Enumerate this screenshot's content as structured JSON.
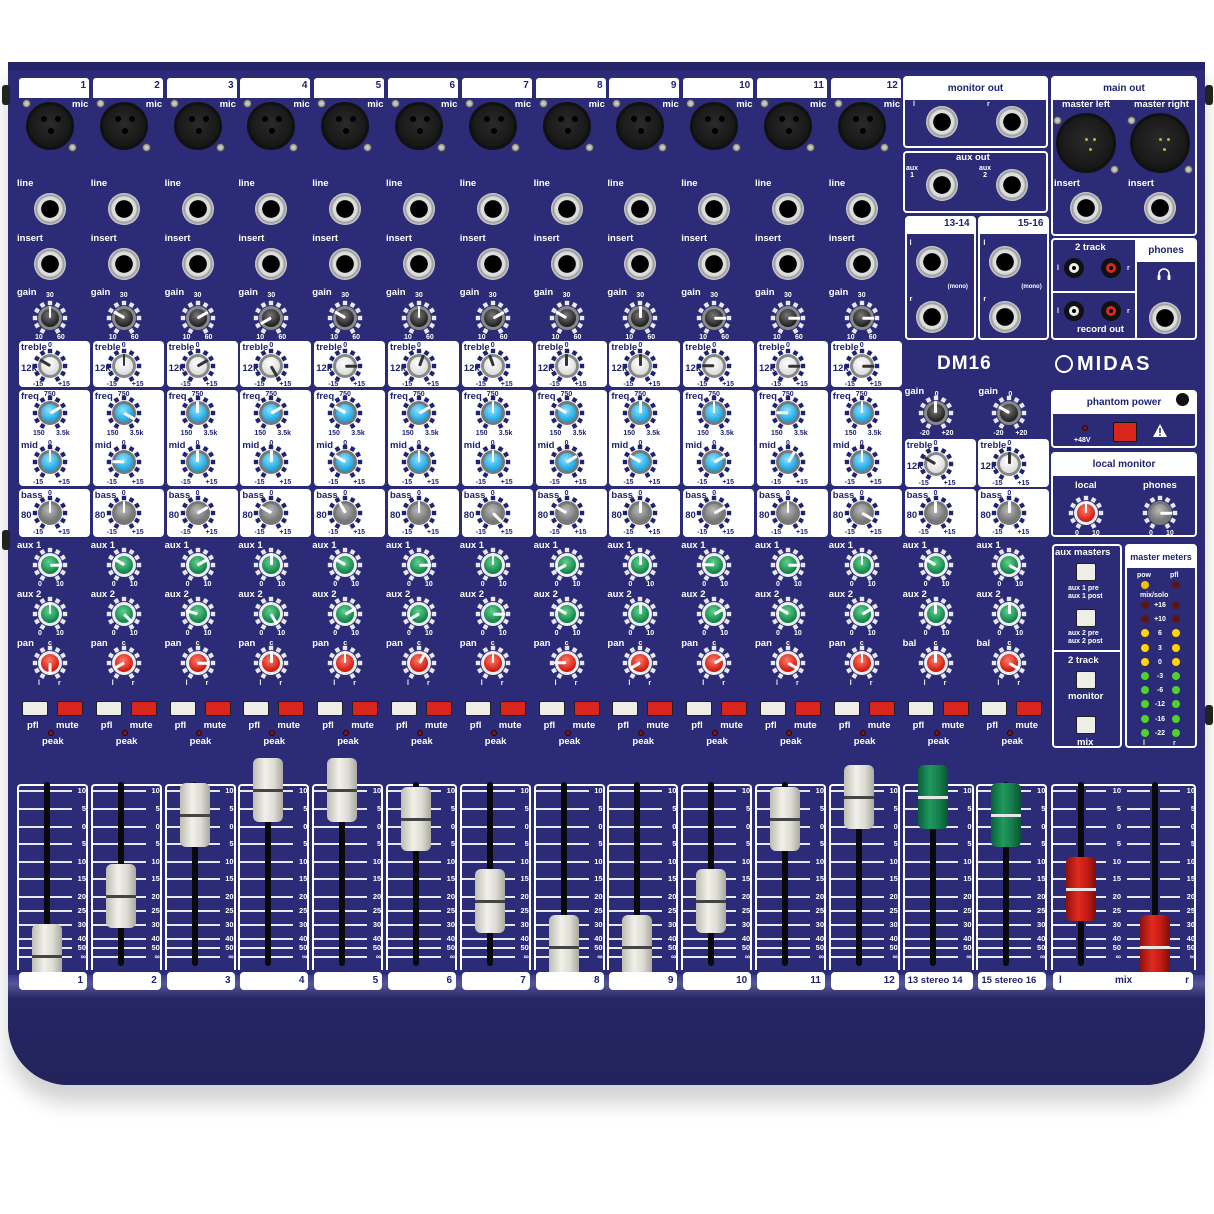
{
  "product": {
    "brand": "MIDAS",
    "model": "DM16"
  },
  "colors": {
    "panel": "#2b2b78",
    "label_dark": "#1f2370",
    "mute_red": "#d9261c",
    "knob_blue": "#1ba4e0",
    "knob_green": "#12824a",
    "knob_red": "#d01b10"
  },
  "labels": {
    "mic": "mic",
    "line": "line",
    "insert": "insert",
    "gain": "gain",
    "treble": "treble",
    "treble_freq": "12k",
    "freq": "freq",
    "mid": "mid",
    "bass": "bass",
    "bass_freq": "80",
    "aux1": "aux 1",
    "aux2": "aux 2",
    "pan": "pan",
    "bal": "bal",
    "pfl": "pfl",
    "mute": "mute",
    "peak": "peak",
    "gain_min": "10",
    "gain_max": "60",
    "gain_mid": "30",
    "stereo_gain_min": "-20",
    "stereo_gain_max": "+20",
    "stereo_gain_mid": "0",
    "eq_min": "-15",
    "eq_max": "+15",
    "eq_mid": "0",
    "freq_min": "150",
    "freq_max": "3.5k",
    "freq_mid": "750",
    "aux_min": "0",
    "aux_max": "10",
    "pan_l": "l",
    "pan_r": "r",
    "pan_c": "c",
    "fader_scale": [
      "10",
      "5",
      "0",
      "5",
      "10",
      "15",
      "20",
      "25",
      "30",
      "40",
      "50",
      "∞"
    ]
  },
  "channels": [
    {
      "number": "1",
      "gain_deg": 0,
      "treble_deg": -60,
      "freq_deg": 60,
      "mid_deg": 0,
      "bass_deg": 0,
      "aux1_deg": 90,
      "aux2_deg": 0,
      "pan_deg": 180,
      "fader_db": "-∞"
    },
    {
      "number": "2",
      "gain_deg": -60,
      "treble_deg": 0,
      "freq_deg": 120,
      "mid_deg": -90,
      "bass_deg": 0,
      "aux1_deg": -60,
      "aux2_deg": 135,
      "pan_deg": -120,
      "fader_db": "-20"
    },
    {
      "number": "3",
      "gain_deg": 60,
      "treble_deg": 60,
      "freq_deg": 0,
      "mid_deg": 0,
      "bass_deg": 60,
      "aux1_deg": 60,
      "aux2_deg": -75,
      "pan_deg": 90,
      "fader_db": "+3"
    },
    {
      "number": "4",
      "gain_deg": -120,
      "treble_deg": 150,
      "freq_deg": 60,
      "mid_deg": 0,
      "bass_deg": -60,
      "aux1_deg": 0,
      "aux2_deg": 150,
      "pan_deg": 0,
      "fader_db": "+10"
    },
    {
      "number": "5",
      "gain_deg": -60,
      "treble_deg": 90,
      "freq_deg": -60,
      "mid_deg": -60,
      "bass_deg": -30,
      "aux1_deg": -60,
      "aux2_deg": 60,
      "pan_deg": 0,
      "fader_db": "+10"
    },
    {
      "number": "6",
      "gain_deg": 0,
      "treble_deg": 20,
      "freq_deg": 60,
      "mid_deg": 0,
      "bass_deg": 0,
      "aux1_deg": 90,
      "aux2_deg": -120,
      "pan_deg": 30,
      "fader_db": "+2"
    },
    {
      "number": "7",
      "gain_deg": 60,
      "treble_deg": -20,
      "freq_deg": 0,
      "mid_deg": 0,
      "bass_deg": 135,
      "aux1_deg": 0,
      "aux2_deg": 90,
      "pan_deg": 0,
      "fader_db": "-22"
    },
    {
      "number": "8",
      "gain_deg": -60,
      "treble_deg": 0,
      "freq_deg": -60,
      "mid_deg": 60,
      "bass_deg": -60,
      "aux1_deg": -120,
      "aux2_deg": -60,
      "pan_deg": -90,
      "fader_db": "-50"
    },
    {
      "number": "9",
      "gain_deg": 0,
      "treble_deg": 0,
      "freq_deg": 0,
      "mid_deg": -60,
      "bass_deg": 0,
      "aux1_deg": 0,
      "aux2_deg": 0,
      "pan_deg": -120,
      "fader_db": "-50"
    },
    {
      "number": "10",
      "gain_deg": 90,
      "treble_deg": -90,
      "freq_deg": 0,
      "mid_deg": 60,
      "bass_deg": 60,
      "aux1_deg": -90,
      "aux2_deg": 60,
      "pan_deg": 60,
      "fader_db": "-22"
    },
    {
      "number": "11",
      "gain_deg": 90,
      "treble_deg": 90,
      "freq_deg": -90,
      "mid_deg": 30,
      "bass_deg": 0,
      "aux1_deg": 90,
      "aux2_deg": -60,
      "pan_deg": 120,
      "fader_db": "+2"
    },
    {
      "number": "12",
      "gain_deg": 90,
      "treble_deg": 90,
      "freq_deg": 0,
      "mid_deg": 0,
      "bass_deg": 120,
      "aux1_deg": 0,
      "aux2_deg": 60,
      "pan_deg": 0,
      "fader_db": "+8"
    }
  ],
  "stereo_channels": [
    {
      "label": "13 stereo 14",
      "input_label": "13-14",
      "mono_label": "(mono)",
      "gain_deg": 0,
      "treble_deg": -60,
      "bass_deg": 0,
      "aux1_deg": -60,
      "aux2_deg": 0,
      "bal_deg": 0,
      "fader_db": "+8"
    },
    {
      "label": "15 stereo 16",
      "input_label": "15-16",
      "mono_label": "(mono)",
      "gain_deg": -60,
      "treble_deg": 0,
      "bass_deg": 0,
      "aux1_deg": 120,
      "aux2_deg": 0,
      "bal_deg": 120,
      "fader_db": "+3"
    }
  ],
  "mix": {
    "label_l": "l",
    "label": "mix",
    "label_r": "r",
    "fader_l_db": "-18",
    "fader_r_db": "-50"
  },
  "monitor_out": {
    "title": "monitor out",
    "l": "l",
    "r": "r"
  },
  "aux_out": {
    "title": "aux out",
    "aux1": "aux\n1",
    "aux2": "aux\n2"
  },
  "main_out": {
    "title": "main out",
    "master_left": "master left",
    "master_right": "master right",
    "insert": "insert"
  },
  "two_track": {
    "title": "2 track",
    "record_out": "record out",
    "l": "l",
    "r": "r"
  },
  "phones": {
    "title": "phones"
  },
  "phantom": {
    "title": "phantom power",
    "led_label": "+48V"
  },
  "local_monitor": {
    "title": "local monitor",
    "local": "local",
    "phones": "phones",
    "local_deg": 0,
    "phones_deg": 90,
    "min": "0",
    "max": "10"
  },
  "aux_masters": {
    "title": "aux masters",
    "aux1_pre": "aux 1 pre",
    "aux1_post": "aux 1 post",
    "aux2_pre": "aux 2 pre",
    "aux2_post": "aux 2 post",
    "two_track_title": "2 track",
    "monitor": "monitor",
    "mix": "mix"
  },
  "master_meters": {
    "title": "master meters",
    "pow": "pow",
    "pfl": "pfl",
    "mix_solo": "mix/solo",
    "l": "l",
    "r": "r",
    "levels": [
      {
        "label": "+16",
        "color": "off-red"
      },
      {
        "label": "+10",
        "color": "off-red"
      },
      {
        "label": "6",
        "color": "yellow"
      },
      {
        "label": "3",
        "color": "yellow"
      },
      {
        "label": "0",
        "color": "yellow"
      },
      {
        "label": "-3",
        "color": "green"
      },
      {
        "label": "-6",
        "color": "green"
      },
      {
        "label": "-12",
        "color": "green"
      },
      {
        "label": "-16",
        "color": "green"
      },
      {
        "label": "-22",
        "color": "green"
      }
    ]
  }
}
